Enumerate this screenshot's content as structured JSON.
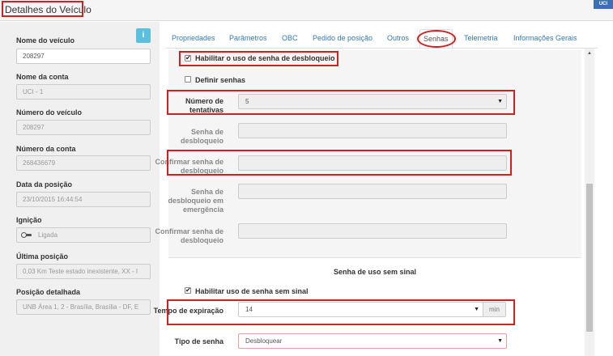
{
  "header": {
    "title": "Detalhes do Veículo",
    "logo_text": "UCI"
  },
  "left_panel": {
    "info_button": "i",
    "fields": [
      {
        "label": "Nome do veículo",
        "value": "208297"
      },
      {
        "label": "Nome da conta",
        "value": "UCI - 1"
      },
      {
        "label": "Número do veículo",
        "value": "208297"
      },
      {
        "label": "Número da conta",
        "value": "268436679"
      },
      {
        "label": "Data da posição",
        "value": "23/10/2015 16:44:54"
      },
      {
        "label": "Ignição",
        "value": "Ligada"
      },
      {
        "label": "Última posição",
        "value": "0,03 Km Teste estado inexistente, XX - I"
      },
      {
        "label": "Posição detalhada",
        "value": "UNB Área 1, 2 - Brasília, Brasília - DF, E"
      }
    ]
  },
  "tabs": [
    "Propriedades",
    "Parâmetros",
    "OBC",
    "Pedido de posição",
    "Outros",
    "Senhas",
    "Telemetria",
    "Informações Gerais"
  ],
  "active_tab": "Senhas",
  "form": {
    "enable_unlock_password": {
      "label": "Habilitar o uso de senha de desbloqueio",
      "checked": true
    },
    "define_passwords": {
      "label": "Definir senhas",
      "checked": false
    },
    "attempts": {
      "label": "Número de tentativas",
      "value": "5"
    },
    "unlock_password": {
      "label": "Senha de desbloqueio",
      "value": ""
    },
    "confirm_unlock_password": {
      "label": "Confirmar senha de desbloqueio",
      "value": ""
    },
    "emergency_password": {
      "label": "Senha de desbloqueio em emergência",
      "value": ""
    },
    "confirm_emergency_password": {
      "label": "Confirmar senha de desbloqueio",
      "value": ""
    },
    "no_signal_section_title": "Senha de uso sem sinal",
    "enable_no_signal_password": {
      "label": "Habilitar uso de senha sem sinal",
      "checked": true
    },
    "expiration_time": {
      "label": "Tempo de expiração",
      "value": "14",
      "unit": "min"
    },
    "password_type": {
      "label": "Tipo de senha",
      "value": "Desbloquear"
    }
  },
  "colors": {
    "highlight": "#d02020",
    "link": "#337ab7",
    "info_button": "#5bc0de"
  }
}
